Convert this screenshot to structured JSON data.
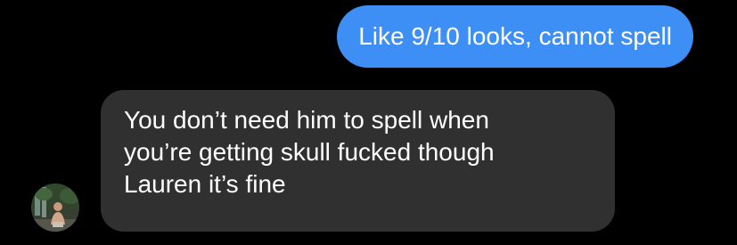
{
  "conversation": {
    "sent_message": {
      "text": "Like 9/10 looks, cannot spell",
      "color": "#3d8ff5"
    },
    "received_message": {
      "lines": [
        "You don’t need him to spell when",
        "you’re getting skull fucked though",
        "Lauren it’s fine"
      ],
      "color": "#303030"
    },
    "contact": {
      "avatar_icon": "contact-avatar-photo"
    }
  }
}
